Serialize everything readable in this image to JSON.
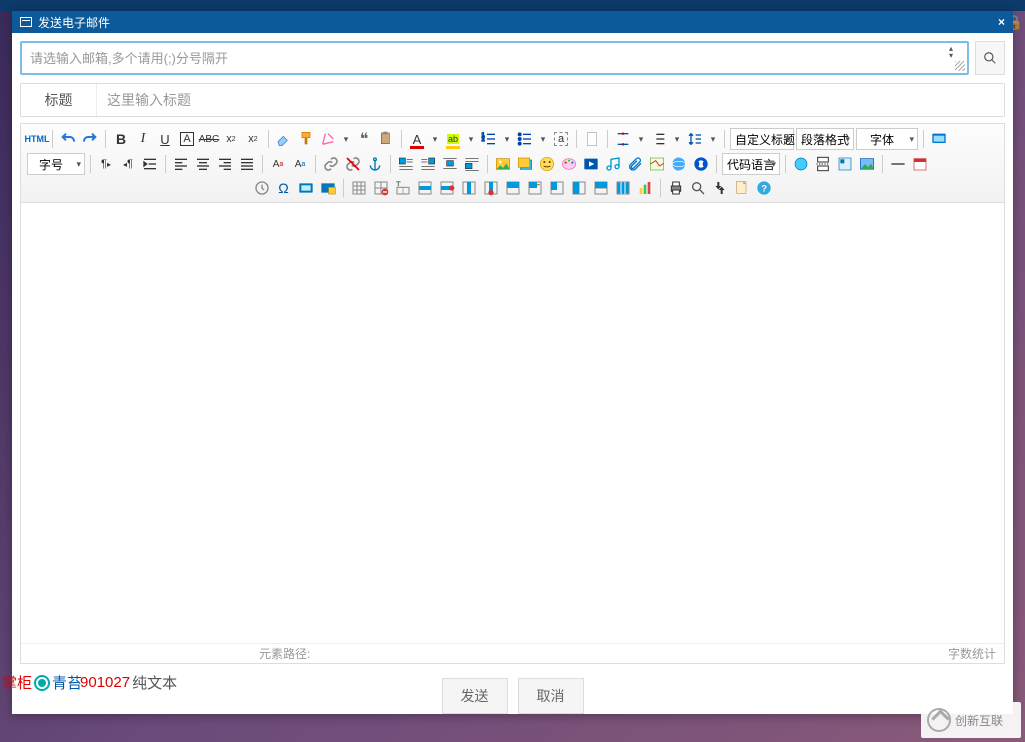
{
  "dialog": {
    "title": "发送电子邮件",
    "close": "×"
  },
  "email": {
    "placeholder": "请选输入邮箱,多个请用(;)分号隔开"
  },
  "title_row": {
    "label": "标题",
    "placeholder": "这里输入标题"
  },
  "toolbar": {
    "html": "HTML",
    "custom_title": "自定义标题",
    "para_format": "段落格式",
    "font_family": "字体",
    "font_size": "字号",
    "code_lang": "代码语言"
  },
  "status": {
    "path_label": "元素路径:",
    "word_count": "字数统计"
  },
  "footer": {
    "send": "发送",
    "cancel": "取消",
    "overlay_red1": "掌柜",
    "overlay_blue": "青苔",
    "overlay_red2": "901027",
    "overlay_black": "纯文本"
  },
  "watermark": "创新互联"
}
